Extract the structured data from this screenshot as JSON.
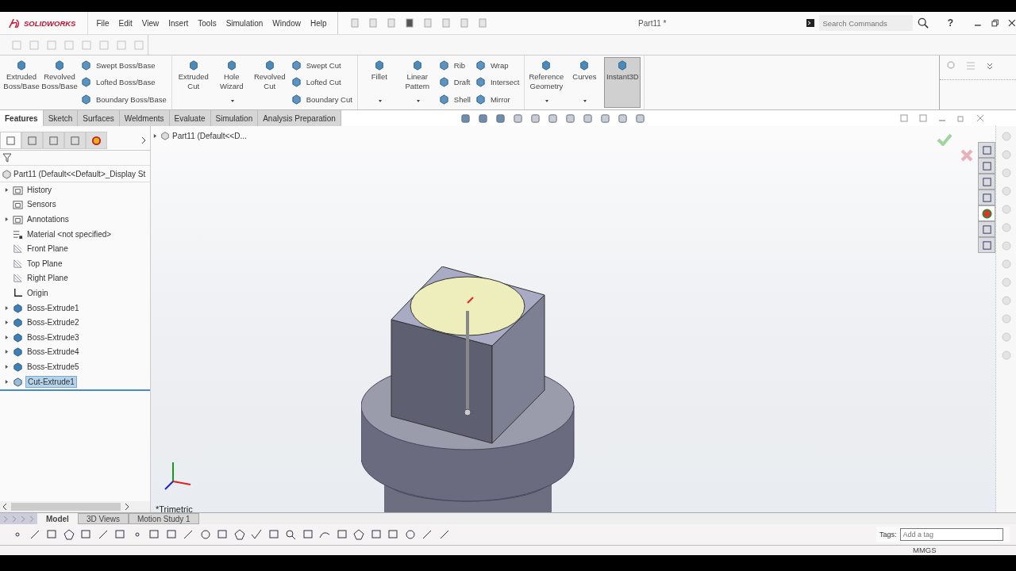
{
  "app": {
    "logo": "SOLIDWORKS"
  },
  "menu": [
    "File",
    "Edit",
    "View",
    "Insert",
    "Tools",
    "Simulation",
    "Window",
    "Help"
  ],
  "document_title": "Part11 *",
  "search": {
    "placeholder": "Search Commands"
  },
  "help": "?",
  "ribbon": [
    {
      "columns": [
        {
          "kind": "large",
          "label": "Extruded Boss/Base",
          "dropdown": false,
          "selected": false
        },
        {
          "kind": "large",
          "label": "Revolved Boss/Base",
          "dropdown": false,
          "selected": false
        },
        {
          "kind": "stack",
          "items": [
            "Swept Boss/Base",
            "Lofted Boss/Base",
            "Boundary Boss/Base"
          ]
        }
      ]
    },
    {
      "columns": [
        {
          "kind": "large",
          "label": "Extruded Cut",
          "dropdown": false,
          "selected": false
        },
        {
          "kind": "large",
          "label": "Hole Wizard",
          "dropdown": true,
          "selected": false
        },
        {
          "kind": "large",
          "label": "Revolved Cut",
          "dropdown": false,
          "selected": false
        },
        {
          "kind": "stack",
          "items": [
            "Swept Cut",
            "Lofted Cut",
            "Boundary Cut"
          ]
        }
      ]
    },
    {
      "columns": [
        {
          "kind": "large",
          "label": "Fillet",
          "dropdown": true,
          "selected": false
        },
        {
          "kind": "large",
          "label": "Linear Pattern",
          "dropdown": true,
          "selected": false
        },
        {
          "kind": "stack",
          "items": [
            "Rib",
            "Draft",
            "Shell"
          ]
        },
        {
          "kind": "stack",
          "items": [
            "Wrap",
            "Intersect",
            "Mirror"
          ]
        }
      ]
    },
    {
      "columns": [
        {
          "kind": "large",
          "label": "Reference Geometry",
          "dropdown": true,
          "selected": false
        },
        {
          "kind": "large",
          "label": "Curves",
          "dropdown": true,
          "selected": false
        },
        {
          "kind": "large",
          "label": "Instant3D",
          "dropdown": false,
          "selected": true
        }
      ]
    }
  ],
  "command_tabs": [
    {
      "label": "Features",
      "selected": true
    },
    {
      "label": "Sketch",
      "selected": false
    },
    {
      "label": "Surfaces",
      "selected": false
    },
    {
      "label": "Weldments",
      "selected": false
    },
    {
      "label": "Evaluate",
      "selected": false
    },
    {
      "label": "Simulation",
      "selected": false
    },
    {
      "label": "Analysis Preparation",
      "selected": false
    }
  ],
  "panel_tabs": [
    {
      "selected": true
    },
    {
      "selected": false
    },
    {
      "selected": false
    },
    {
      "selected": false
    },
    {
      "selected": false
    }
  ],
  "feature_tree": {
    "root": "Part11  (Default<<Default>_Display St",
    "items": [
      {
        "label": "History",
        "kind": "folder",
        "expandable": true,
        "selected": false
      },
      {
        "label": "Sensors",
        "kind": "sensor",
        "expandable": false,
        "selected": false
      },
      {
        "label": "Annotations",
        "kind": "annotation",
        "expandable": true,
        "selected": false
      },
      {
        "label": "Material <not specified>",
        "kind": "material",
        "expandable": false,
        "selected": false
      },
      {
        "label": "Front Plane",
        "kind": "plane",
        "expandable": false,
        "selected": false
      },
      {
        "label": "Top Plane",
        "kind": "plane",
        "expandable": false,
        "selected": false
      },
      {
        "label": "Right Plane",
        "kind": "plane",
        "expandable": false,
        "selected": false
      },
      {
        "label": "Origin",
        "kind": "origin",
        "expandable": false,
        "selected": false
      },
      {
        "label": "Boss-Extrude1",
        "kind": "feature",
        "expandable": true,
        "selected": false
      },
      {
        "label": "Boss-Extrude2",
        "kind": "feature",
        "expandable": true,
        "selected": false
      },
      {
        "label": "Boss-Extrude3",
        "kind": "feature",
        "expandable": true,
        "selected": false
      },
      {
        "label": "Boss-Extrude4",
        "kind": "feature",
        "expandable": true,
        "selected": false
      },
      {
        "label": "Boss-Extrude5",
        "kind": "feature",
        "expandable": true,
        "selected": false
      },
      {
        "label": "Cut-Extrude1",
        "kind": "cut",
        "expandable": true,
        "selected": true
      }
    ]
  },
  "viewport": {
    "breadcrumb": "Part11  (Default<<D...",
    "view_name": "*Trimetric"
  },
  "bottom_tabs": [
    {
      "label": "Model",
      "selected": true
    },
    {
      "label": "3D Views",
      "selected": false
    },
    {
      "label": "Motion Study 1",
      "selected": false
    }
  ],
  "tags": {
    "label": "Tags:",
    "placeholder": "Add a tag"
  },
  "status_bar": {
    "units": "MMGS"
  }
}
